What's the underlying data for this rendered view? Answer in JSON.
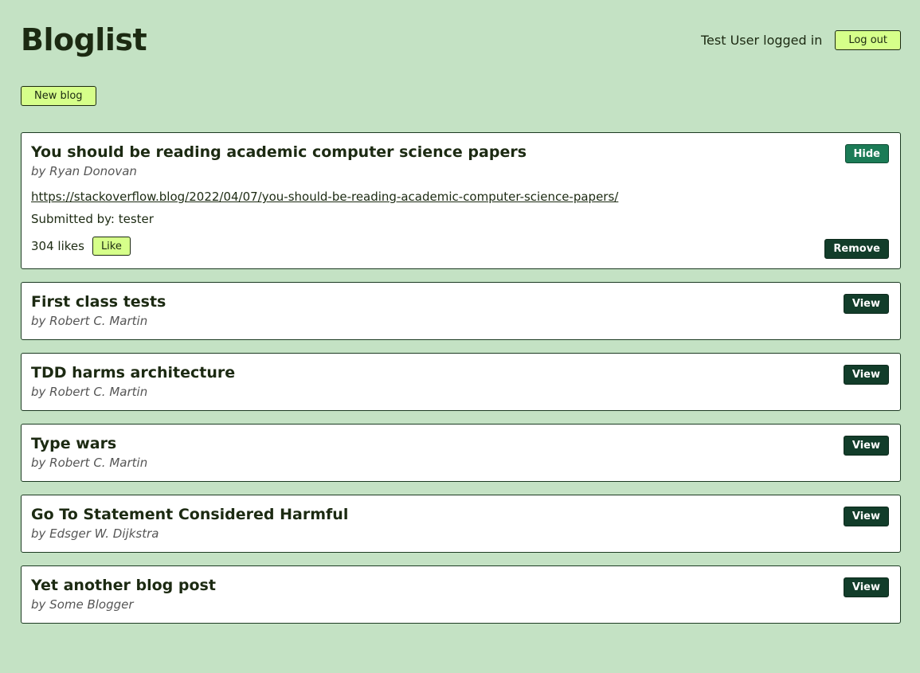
{
  "header": {
    "title": "Bloglist",
    "user_text": "Test User logged in",
    "logout_label": "Log out"
  },
  "new_blog_label": "New blog",
  "expanded_blog": {
    "title": "You should be reading academic computer science papers",
    "author": "by Ryan Donovan",
    "url": "https://stackoverflow.blog/2022/04/07/you-should-be-reading-academic-computer-science-papers/",
    "submitted": "Submitted by: tester",
    "likes": "304 likes",
    "like_label": "Like",
    "hide_label": "Hide",
    "remove_label": "Remove"
  },
  "blogs": [
    {
      "title": "First class tests",
      "author": "by Robert C. Martin",
      "view_label": "View"
    },
    {
      "title": "TDD harms architecture",
      "author": "by Robert C. Martin",
      "view_label": "View"
    },
    {
      "title": "Type wars",
      "author": "by Robert C. Martin",
      "view_label": "View"
    },
    {
      "title": "Go To Statement Considered Harmful",
      "author": "by Edsger W. Dijkstra",
      "view_label": "View"
    },
    {
      "title": "Yet another blog post",
      "author": "by Some Blogger",
      "view_label": "View"
    }
  ],
  "colors": {
    "background": "#c4e2c4",
    "lime_button": "#d6ff8a",
    "dark_button": "#123d2a",
    "hide_button": "#1b7b56"
  }
}
